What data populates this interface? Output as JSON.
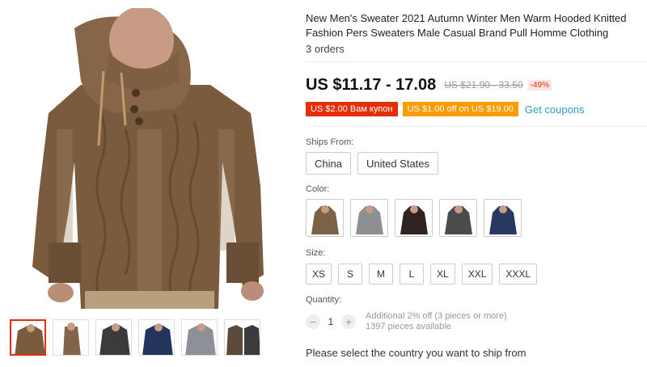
{
  "product": {
    "title": "New Men's Sweater 2021 Autumn Winter Men Warm Hooded Knitted Fashion Pers Sweaters Male Casual Brand Pull Homme Clothing",
    "orders": "3 orders"
  },
  "pricing": {
    "price": "US $11.17 - 17.08",
    "old_price": "US $21.90 - 33.50",
    "discount": "-49%"
  },
  "coupons": {
    "items": [
      "US $2.00 Вам купон",
      "US $1.00 off on US $19.00"
    ],
    "get_coupons": "Get coupons"
  },
  "ships_from": {
    "label": "Ships From:",
    "options": [
      "China",
      "United States"
    ]
  },
  "color": {
    "label": "Color:",
    "swatches": [
      "#7a6247",
      "#8d8f93",
      "#2f2220",
      "#4a4b4d",
      "#263860"
    ]
  },
  "size": {
    "label": "Size:",
    "options": [
      "XS",
      "S",
      "M",
      "L",
      "XL",
      "XXL",
      "XXXL"
    ]
  },
  "quantity": {
    "label": "Quantity:",
    "minus": "−",
    "value": "1",
    "plus": "+",
    "note_1": "Additional 2% off (3 pieces or more)",
    "note_2": "1397 pieces available"
  },
  "shipping_note": "Please select the country you want to ship from",
  "thumbnail_colors": [
    "#7a5b3e",
    "#80654a",
    "#3b3b3d",
    "#25345b",
    "#8d9096",
    "#5b4a3a"
  ]
}
